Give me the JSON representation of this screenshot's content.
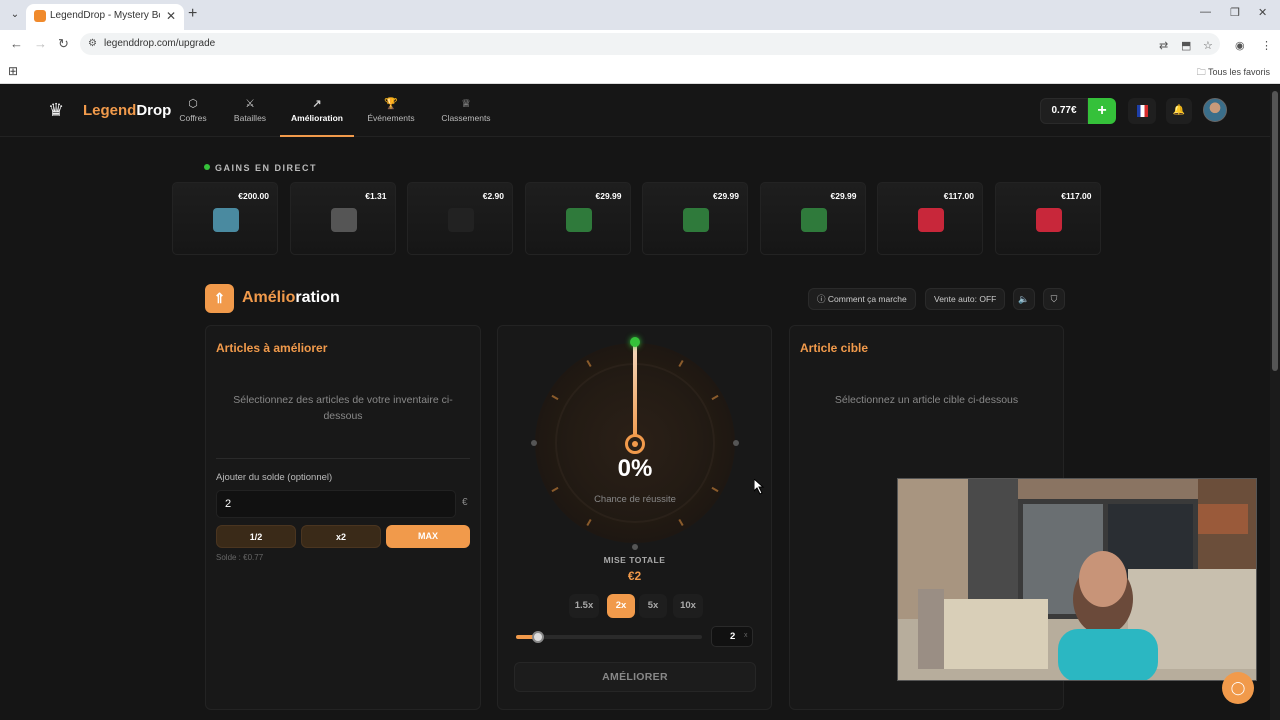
{
  "browser": {
    "tab_title": "LegendDrop - Mystery Boxes & ...",
    "url": "legenddrop.com/upgrade",
    "bookmark_folder": "Tous les favoris"
  },
  "header": {
    "logo_part1": "Legend",
    "logo_part2": "Drop",
    "nav": [
      {
        "label": "Coffres",
        "icon": "box-icon"
      },
      {
        "label": "Batailles",
        "icon": "swords-icon"
      },
      {
        "label": "Amélioration",
        "icon": "trend-up-icon"
      },
      {
        "label": "Événements",
        "icon": "trophy-icon"
      },
      {
        "label": "Classements",
        "icon": "crown-icon"
      }
    ],
    "balance": "0.77€",
    "plus": "+"
  },
  "live": {
    "title": "GAINS EN DIRECT",
    "drops": [
      {
        "price": "€200.00",
        "color": "#4a8aa0"
      },
      {
        "price": "€1.31",
        "color": "#555555"
      },
      {
        "price": "€2.90",
        "color": "#222222"
      },
      {
        "price": "€29.99",
        "color": "#2f7a3b"
      },
      {
        "price": "€29.99",
        "color": "#2f7a3b"
      },
      {
        "price": "€29.99",
        "color": "#2f7a3b"
      },
      {
        "price": "€117.00",
        "color": "#c8273a"
      },
      {
        "price": "€117.00",
        "color": "#c8273a"
      }
    ]
  },
  "upgrade": {
    "title_part1": "Amélio",
    "title_part2": "ration",
    "how_it_works": "Comment ça marche",
    "auto_sell": "Vente auto: OFF",
    "left": {
      "title": "Articles à améliorer",
      "hint": "Sélectionnez des articles de votre inventaire ci-dessous",
      "add_balance_label": "Ajouter du solde (optionnel)",
      "amount": "2",
      "currency": "€",
      "btn_half": "1/2",
      "btn_double": "x2",
      "btn_max": "MAX",
      "solde": "Solde : €0.77"
    },
    "center": {
      "percent": "0%",
      "chance_label": "Chance de réussite",
      "mise_label": "MISE TOTALE",
      "mise_value": "€2",
      "multipliers": [
        "1.5x",
        "2x",
        "5x",
        "10x"
      ],
      "active_multiplier": "2x",
      "slider_value": 0.12,
      "mult_input": "2",
      "mult_suffix": "x",
      "button": "AMÉLIORER"
    },
    "right": {
      "title": "Article cible",
      "hint": "Sélectionnez un article cible ci-dessous"
    }
  }
}
